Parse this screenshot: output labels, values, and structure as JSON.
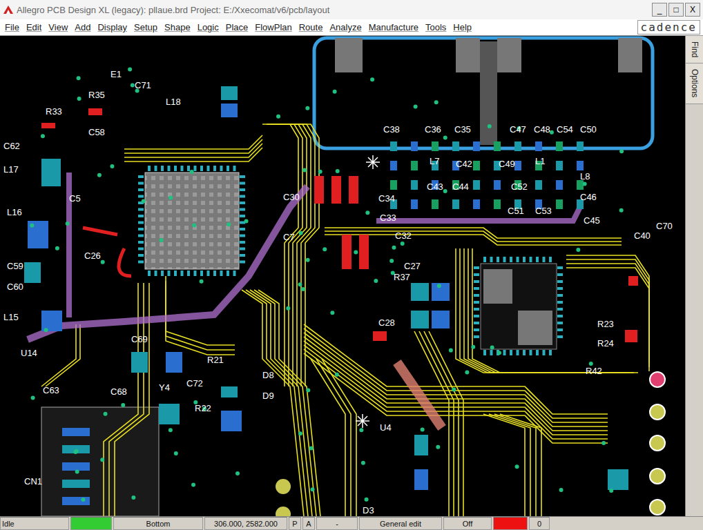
{
  "window": {
    "title": "Allegro PCB Design XL (legacy): pllaue.brd  Project: E:/Xxecomat/v6/pcb/layout",
    "controls": [
      "_",
      "□",
      "X"
    ]
  },
  "menu": [
    "File",
    "Edit",
    "View",
    "Add",
    "Display",
    "Setup",
    "Shape",
    "Logic",
    "Place",
    "FlowPlan",
    "Route",
    "Analyze",
    "Manufacture",
    "Tools",
    "Help"
  ],
  "logo": "cadence",
  "side_tabs": [
    {
      "label": "Find",
      "selected": false
    },
    {
      "label": "Options",
      "selected": false
    }
  ],
  "board": {
    "labels": [
      "E1",
      "C71",
      "R35",
      "R33",
      "C58",
      "C62",
      "L17",
      "C5",
      "L16",
      "C59",
      "C60",
      "L15",
      "U14",
      "C63",
      "C69",
      "C68",
      "Y4",
      "C72",
      "R22",
      "R21",
      "D8",
      "D9",
      "C38",
      "C36",
      "C35",
      "C47",
      "C48",
      "C54",
      "C50",
      "L7",
      "C42",
      "C49",
      "L1",
      "L8",
      "C43",
      "C44",
      "C52",
      "C34",
      "C46",
      "C33",
      "C51",
      "C53",
      "C45",
      "C32",
      "C27",
      "R37",
      "C28",
      "U4",
      "D3",
      "CN1",
      "R23",
      "R24",
      "R42",
      "C40",
      "C70",
      "C26",
      "L18",
      "C30",
      "C7"
    ]
  },
  "status_bar": {
    "fields": [
      {
        "kind": "text",
        "text": "Idle"
      },
      {
        "kind": "swatch",
        "text": "",
        "color": "#33cc33"
      },
      {
        "kind": "text",
        "text": "Bottom"
      },
      {
        "kind": "text",
        "text": "306.000, 2582.000"
      },
      {
        "kind": "text",
        "text": "P"
      },
      {
        "kind": "text",
        "text": "A"
      },
      {
        "kind": "text",
        "text": "-"
      },
      {
        "kind": "text",
        "text": "General edit"
      },
      {
        "kind": "text",
        "text": "Off"
      },
      {
        "kind": "swatch",
        "text": "",
        "color": "#ee1111"
      },
      {
        "kind": "text",
        "text": "0"
      }
    ]
  }
}
